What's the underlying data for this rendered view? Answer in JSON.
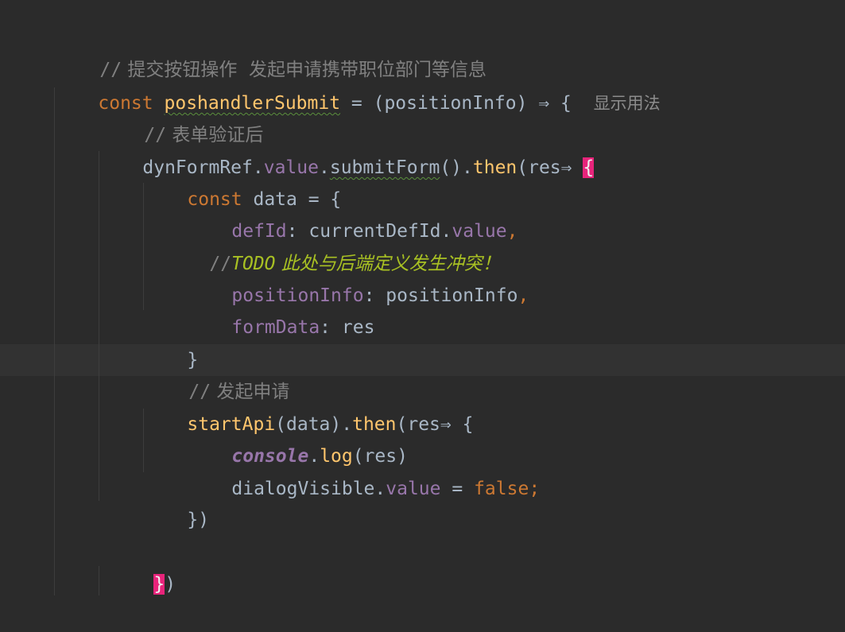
{
  "code": {
    "line1": {
      "slashes": "//",
      "text": " 提交按钮操作  发起申请携带职位部门等信息"
    },
    "line2": {
      "kw_const": "const",
      "fn_name": "poshandlerSubmit",
      "eq": " = (",
      "param": "positionInfo",
      "arrow": ") ⇒ {",
      "hint": "显示用法"
    },
    "line3": {
      "slashes": "//",
      "text": " 表单验证后"
    },
    "line4": {
      "obj": "dynFormRef",
      "dot1": ".",
      "value": "value",
      "dot2": ".",
      "method": "submitForm",
      "call": "().",
      "then": "then",
      "args": "(res⇒ ",
      "brace": "{"
    },
    "line5": {
      "kw_const": "const",
      "rest": " data = {"
    },
    "line6": {
      "key": "defId",
      "colon": ": ",
      "obj": "currentDefId",
      "dot": ".",
      "value": "value",
      "comma": ","
    },
    "line7": {
      "slashes": "//",
      "todo": "TODO",
      "text": " 此处与后端定义发生冲突！"
    },
    "line8": {
      "key": "positionInfo",
      "colon": ": ",
      "val": "positionInfo",
      "comma": ","
    },
    "line9": {
      "key": "formData",
      "colon": ": ",
      "val": "res"
    },
    "line10": {
      "text": "}"
    },
    "line11": {
      "slashes": "//",
      "text": " 发起申请"
    },
    "line12": {
      "fn": "startApi",
      "args": "(data).",
      "then": "then",
      "rest": "(res⇒ {"
    },
    "line13": {
      "console": "console",
      "dot": ".",
      "log": "log",
      "args": "(res)"
    },
    "line14": {
      "obj": "dialogVisible",
      "dot": ".",
      "value": "value",
      "eq": " = ",
      "val": "false",
      "semi": ";"
    },
    "line15": {
      "text": "})"
    },
    "line17": {
      "brace": "}",
      "paren": ")"
    }
  },
  "colors": {
    "background": "#2b2b2b",
    "current_line": "#323232",
    "keyword": "#cc7832",
    "function": "#ffc66d",
    "property": "#9876aa",
    "default_text": "#a9b7c6",
    "comment": "#808080",
    "todo": "#a8c023",
    "brace_highlight": "#e8247b"
  }
}
